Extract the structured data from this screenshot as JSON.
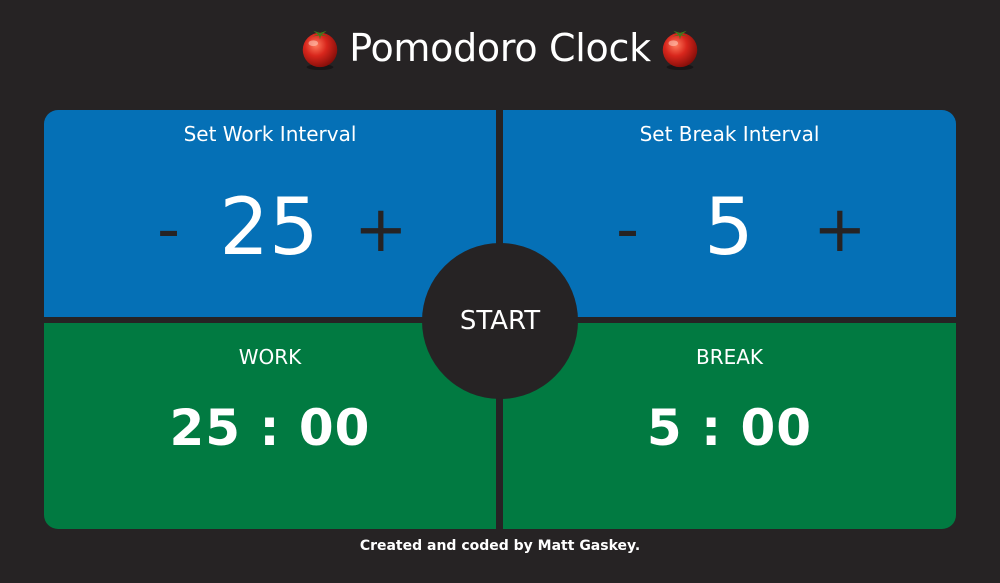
{
  "header": {
    "title": "Pomodoro Clock",
    "icon_left": "tomato-icon",
    "icon_right": "tomato-icon"
  },
  "work_setter": {
    "label": "Set Work Interval",
    "decrement": "-",
    "value": "25",
    "increment": "+"
  },
  "break_setter": {
    "label": "Set Break Interval",
    "decrement": "-",
    "value": "5",
    "increment": "+"
  },
  "work_display": {
    "label": "WORK",
    "time": "25 : 00"
  },
  "break_display": {
    "label": "BREAK",
    "time": "5 : 00"
  },
  "start_button": {
    "label": "START"
  },
  "footer": {
    "text": "Created and coded by Matt Gaskey."
  },
  "colors": {
    "background": "#262324",
    "setter_blue": "#0570b6",
    "display_green": "#017a41",
    "text": "#ffffff",
    "control_dark": "#262324",
    "tomato_red": "#c8241c"
  }
}
